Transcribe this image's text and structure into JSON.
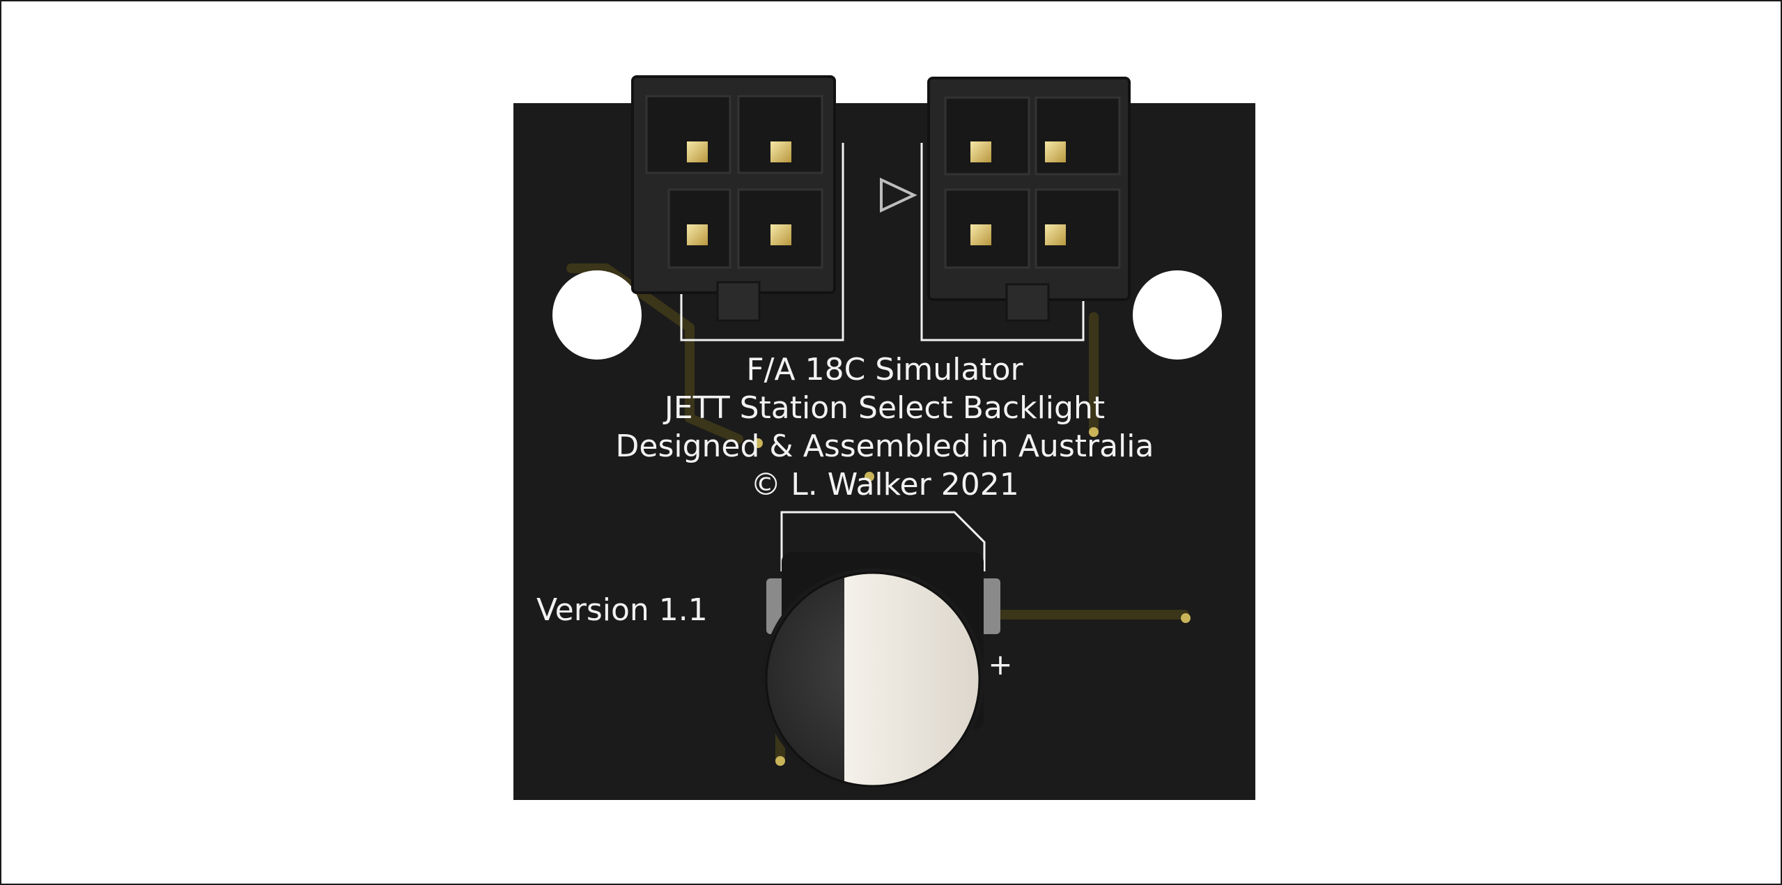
{
  "board": {
    "silkscreen": {
      "line1": "F/A 18C Simulator",
      "line2": "JETT Station Select Backlight",
      "line3": "Designed & Assembled in Australia",
      "line4": "© L. Walker 2021",
      "version": "Version 1.1",
      "polarity_mark": "+"
    }
  },
  "colors": {
    "background": "#ffffff",
    "pcb": "#1b1b1b",
    "silkscreen": "#f2f2f2",
    "trace": "#3a3418",
    "pin_gold": "#e3cf7c",
    "capacitor_stripe": "#ede8df",
    "capacitor_body": "#2d2d2d"
  }
}
